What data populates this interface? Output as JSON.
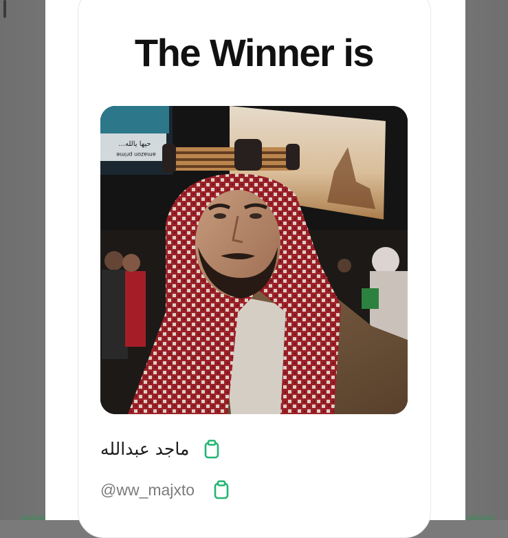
{
  "card": {
    "title": "The Winner is",
    "winner_name": "ماجد عبدالله",
    "winner_handle": "@ww_majxto"
  },
  "photo": {
    "billboard_text_top": "...حيها يالله",
    "billboard_text_bottom": "amazon prime"
  },
  "icons": {
    "name_copy": "clipboard-icon",
    "handle_copy": "clipboard-icon"
  },
  "colors": {
    "accent_green": "#22b573",
    "title": "#111111",
    "handle": "#7b7b7b",
    "backdrop": "#7a7a7a"
  }
}
